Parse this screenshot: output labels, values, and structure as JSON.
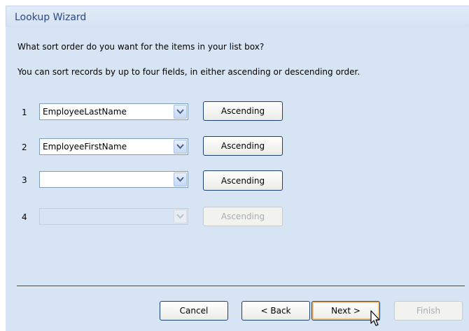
{
  "window": {
    "title": "Lookup Wizard"
  },
  "prompt": {
    "question": "What sort order do you want for the items in your list box?",
    "hint": "You can sort records by up to four fields, in either ascending or descending order."
  },
  "sort_rows": [
    {
      "number": "1",
      "field": "EmployeeLastName",
      "order": "Ascending",
      "enabled": true
    },
    {
      "number": "2",
      "field": "EmployeeFirstName",
      "order": "Ascending",
      "enabled": true
    },
    {
      "number": "3",
      "field": "",
      "order": "Ascending",
      "enabled": true
    },
    {
      "number": "4",
      "field": "",
      "order": "Ascending",
      "enabled": false
    }
  ],
  "buttons": {
    "cancel": "Cancel",
    "back": "< Back",
    "next": "Next >",
    "finish": "Finish"
  },
  "icons": {
    "dropdown": "chevron-down-icon",
    "cursor": "mouse-cursor-icon"
  },
  "colors": {
    "title_text": "#2a4a86",
    "client_bg": "#d7e4f3",
    "button_border": "#1f3f77"
  }
}
